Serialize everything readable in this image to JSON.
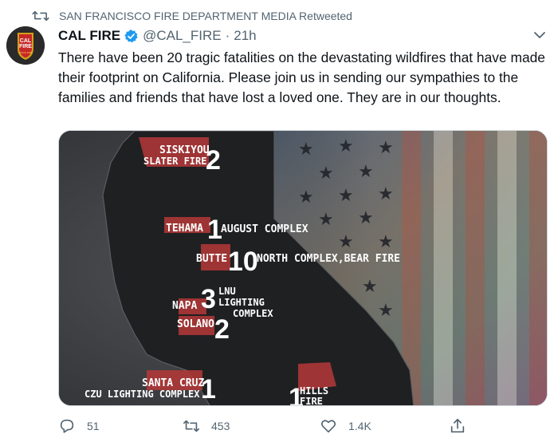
{
  "retweet_context": {
    "icon": "retweet-icon",
    "text": "SAN FRANCISCO FIRE DEPARTMENT MEDIA Retweeted"
  },
  "tweet": {
    "author_name": "CAL FIRE",
    "handle": "@CAL_FIRE",
    "separator": "·",
    "time": "21h",
    "text": "There have been 20 tragic fatalities on the devastating wildfires that have made their footprint on California.  Please join us in sending our sympathies to the families and friends that have lost a loved one. They are in our thoughts."
  },
  "avatar": {
    "logo_text_1": "CAL",
    "logo_text_2": "FIRE",
    "logo_text_3": "SINCE 1885"
  },
  "media": {
    "labels": [
      {
        "region": "SISKIYOU",
        "sub": "SLATER FIRE",
        "count": "2"
      },
      {
        "region": "TEHAMA",
        "count": "1",
        "fire": "AUGUST COMPLEX"
      },
      {
        "region": "BUTTE",
        "count": "10",
        "fire": "NORTH COMPLEX,BEAR FIRE"
      },
      {
        "count": "3",
        "fire_l1": "LNU",
        "fire_l2": "LIGHTING",
        "fire_l3": "COMPLEX"
      },
      {
        "region": "NAPA"
      },
      {
        "region": "SOLANO",
        "count": "2"
      },
      {
        "region": "SANTA CRUZ",
        "sub": "CZU LIGHTING COMPLEX",
        "count": "1"
      },
      {
        "count": "1",
        "fire_l1": "HILLS",
        "fire_l2": "FIRE"
      }
    ]
  },
  "actions": {
    "reply_count": "51",
    "retweet_count": "453",
    "like_count": "1.4K"
  },
  "colors": {
    "accent": "#1d9bf0",
    "muted": "#536471",
    "region_red": "#c0392b"
  }
}
